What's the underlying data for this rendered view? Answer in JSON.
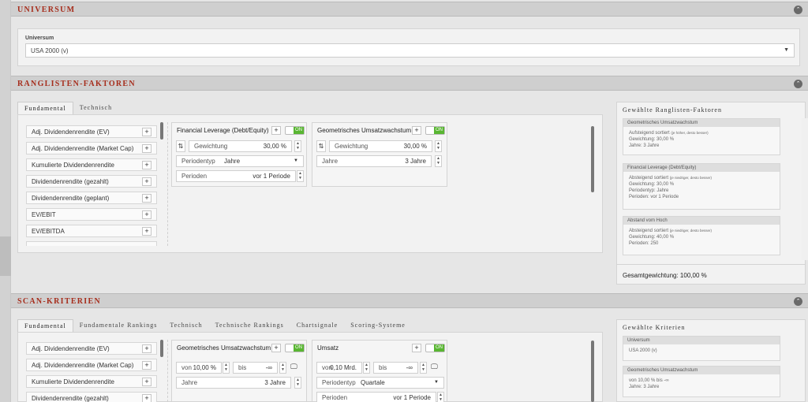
{
  "universum": {
    "title": "Universum",
    "label": "Universum",
    "selected": "USA 2000 (v)"
  },
  "ranking": {
    "title": "Ranglisten-Faktoren",
    "tabs": [
      "Fundamental",
      "Technisch"
    ],
    "list": [
      "Adj. Dividendenrendite (EV)",
      "Adj. Dividendenrendite (Market Cap)",
      "Kumulierte Dividendenrendite",
      "Dividendenrendite (gezahlt)",
      "Dividendenrendite (geplant)",
      "EV/EBIT",
      "EV/EBITDA"
    ],
    "card1": {
      "title": "Financial Leverage (Debt/Equity)",
      "toggle": "ON",
      "weight_label": "Gewichtung",
      "weight_value": "30,00 %",
      "ptype_label": "Periodentyp",
      "ptype_value": "Jahre",
      "periods_label": "Perioden",
      "periods_value": "vor 1 Periode"
    },
    "card2": {
      "title": "Geometrisches Umsatzwachstum",
      "toggle": "ON",
      "weight_label": "Gewichtung",
      "weight_value": "30,00 %",
      "years_label": "Jahre",
      "years_value": "3 Jahre"
    },
    "selected_title": "Gewählte Ranglisten-Faktoren",
    "selected": [
      {
        "name": "Geometrisches Umsatzwachstum",
        "sort": "Aufsteigend sortiert",
        "sort_note": "(je höher, desto besser)",
        "lines": [
          "Gewichtung: 30,00 %",
          "Jahre: 3 Jahre"
        ]
      },
      {
        "name": "Financial Leverage (Debt/Equity)",
        "sort": "Absteigend sortiert",
        "sort_note": "(je niedriger, desto besser)",
        "lines": [
          "Gewichtung: 30,00 %",
          "Periodentyp: Jahre",
          "Perioden: vor 1 Periode"
        ]
      },
      {
        "name": "Abstand vom Hoch",
        "sort": "Absteigend sortiert",
        "sort_note": "(je niedriger, desto besser)",
        "lines": [
          "Gewichtung: 40,00 %",
          "Perioden: 250"
        ]
      }
    ],
    "total": "Gesamtgewichtung: 100,00 %"
  },
  "scan": {
    "title": "Scan-Kriterien",
    "tabs": [
      "Fundamental",
      "Fundamentale Rankings",
      "Technisch",
      "Technische Rankings",
      "Chartsignale",
      "Scoring-Systeme"
    ],
    "list": [
      "Adj. Dividendenrendite (EV)",
      "Adj. Dividendenrendite (Market Cap)",
      "Kumulierte Dividendenrendite",
      "Dividendenrendite (gezahlt)"
    ],
    "card1": {
      "title": "Geometrisches Umsatzwachstum",
      "toggle": "ON",
      "von": "von",
      "von_value": "10,00 %",
      "bis": "bis",
      "bis_value": "-∞",
      "years_label": "Jahre",
      "years_value": "3 Jahre"
    },
    "card2": {
      "title": "Umsatz",
      "toggle": "ON",
      "von": "von",
      "von_value": "0,10 Mrd.",
      "bis": "bis",
      "bis_value": "-∞",
      "ptype_label": "Periodentyp",
      "ptype_value": "Quartale",
      "periods_label": "Perioden",
      "periods_value": "vor 1 Periode"
    },
    "selected_title": "Gewählte Kriterien",
    "selected": [
      {
        "name": "Universum",
        "lines": [
          "USA 2000 (v)"
        ]
      },
      {
        "name": "Geometrisches Umsatzwachstum",
        "lines": [
          "von 10,00 % bis -∞",
          "Jahre: 3 Jahre"
        ]
      }
    ]
  }
}
